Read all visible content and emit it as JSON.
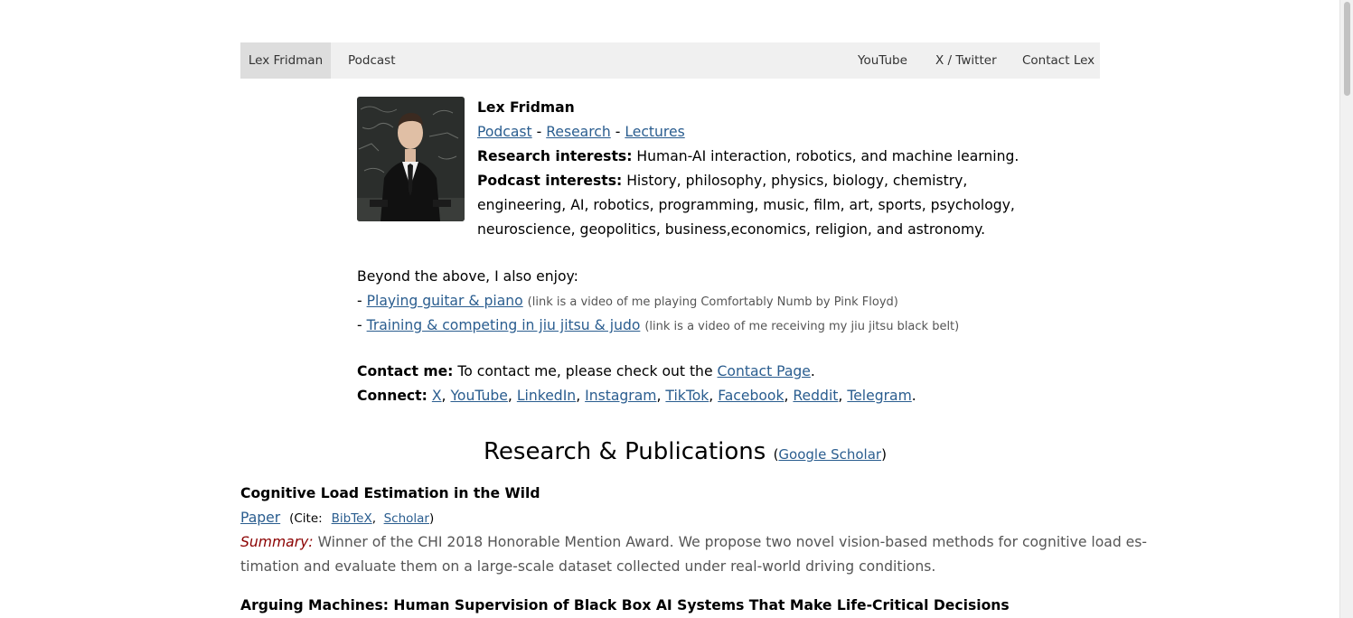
{
  "nav": {
    "left": [
      "Lex Fridman",
      "Podcast"
    ],
    "right": [
      "YouTube",
      "X / Twitter",
      "Contact Lex"
    ]
  },
  "profile": {
    "name": "Lex Fridman",
    "links": [
      "Podcast",
      "Research",
      "Lectures"
    ],
    "separator": "-",
    "research_label": "Research interests:",
    "research_text": "Human-AI interaction, robotics, and machine learning.",
    "podcast_label": "Podcast interests:",
    "podcast_text_1": "History, philosophy, physics, biology, chemistry,",
    "podcast_text_2": "engineering, AI, robotics, programming, music, film, art, sports, psychology,",
    "podcast_text_3": "neuroscience, geopolitics, business,economics, religion, and astronomy."
  },
  "enjoy": {
    "intro": "Beyond the above, I also enjoy:",
    "bullet": "-",
    "items": [
      {
        "link": "Playing guitar & piano",
        "note": "(link is a video of me playing Comfortably Numb by Pink Floyd)"
      },
      {
        "link": "Training & competing in jiu jitsu & judo",
        "note": "(link is a video of me receiving my jiu jitsu black belt)"
      }
    ]
  },
  "contact": {
    "label": "Contact me:",
    "text": "To contact me, please check out the",
    "link": "Contact Page",
    "end": "."
  },
  "connect": {
    "label": "Connect:",
    "links": [
      "X",
      "YouTube",
      "LinkedIn",
      "Instagram",
      "TikTok",
      "Facebook",
      "Reddit",
      "Telegram"
    ],
    "comma": ",",
    "end": "."
  },
  "research": {
    "title": "Research & Publications",
    "open": "(",
    "scholar": "Google Scholar",
    "close": ")"
  },
  "papers": [
    {
      "title": "Cognitive Load Estimation in the Wild",
      "paper_link": "Paper",
      "cite_open": "(Cite:",
      "bibtex": "BibTeX",
      "scholar": "Scholar",
      "cite_comma": ",",
      "cite_close": ")",
      "summary_label": "Summary:",
      "summary_1": "Winner of the CHI 2018 Honorable Mention Award. We propose two novel vision-based methods for cognitive load es-",
      "summary_2": "timation and evaluate them on a large-scale dataset collected under real-world driving conditions."
    },
    {
      "title": "Arguing Machines: Human Supervision of Black Box AI Systems That Make Life-Critical Decisions"
    }
  ]
}
